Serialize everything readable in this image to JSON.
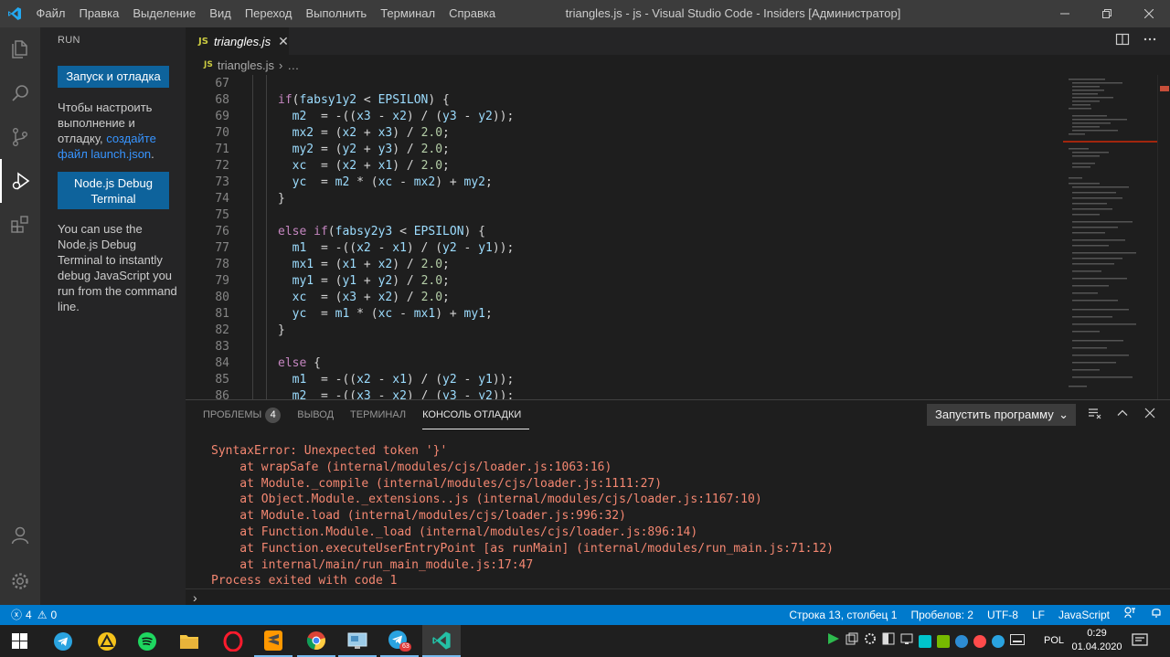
{
  "titlebar": {
    "menu": [
      "Файл",
      "Правка",
      "Выделение",
      "Вид",
      "Переход",
      "Выполнить",
      "Терминал",
      "Справка"
    ],
    "title": "triangles.js - js - Visual Studio Code - Insiders [Администратор]"
  },
  "sidebar": {
    "title": "RUN",
    "run_button": "Запуск и отладка",
    "configure_text": "Чтобы настроить выполнение и отладку, ",
    "configure_link": "создайте файл launch.json",
    "configure_end": ".",
    "node_button": "Node.js Debug Terminal",
    "node_text": "You can use the Node.js Debug Terminal to instantly debug JavaScript you run from the command line."
  },
  "editor": {
    "tab_name": "triangles.js",
    "badge": "JS",
    "breadcrumb_file": "triangles.js",
    "breadcrumb_rest": "…",
    "line_numbers": [
      "67",
      "68",
      "69",
      "70",
      "71",
      "72",
      "73",
      "74",
      "75",
      "76",
      "77",
      "78",
      "79",
      "80",
      "81",
      "82",
      "83",
      "84",
      "85",
      "86"
    ]
  },
  "panel": {
    "tabs": [
      "ПРОБЛЕМЫ",
      "ВЫВОД",
      "ТЕРМИНАЛ",
      "КОНСОЛЬ ОТЛАДКИ"
    ],
    "problems_count": "4",
    "launch_select": "Запустить программу",
    "console_lines": [
      "SyntaxError: Unexpected token '}'",
      "    at wrapSafe (internal/modules/cjs/loader.js:1063:16)",
      "    at Module._compile (internal/modules/cjs/loader.js:1111:27)",
      "    at Object.Module._extensions..js (internal/modules/cjs/loader.js:1167:10)",
      "    at Module.load (internal/modules/cjs/loader.js:996:32)",
      "    at Function.Module._load (internal/modules/cjs/loader.js:896:14)",
      "    at Function.executeUserEntryPoint [as runMain] (internal/modules/run_main.js:71:12)",
      "    at internal/main/run_main_module.js:17:47",
      "Process exited with code 1"
    ],
    "prompt": "›"
  },
  "statusbar": {
    "errors": "4",
    "warnings": "0",
    "position": "Строка 13, столбец 1",
    "spaces": "Пробелов: 2",
    "encoding": "UTF-8",
    "eol": "LF",
    "language": "JavaScript"
  },
  "taskbar": {
    "tray_lang": "POL",
    "time": "0:29",
    "date": "01.04.2020",
    "telegram_badge": "63"
  },
  "colors": {
    "accent": "#007acc",
    "button": "#0e639c",
    "error": "#f48771"
  }
}
